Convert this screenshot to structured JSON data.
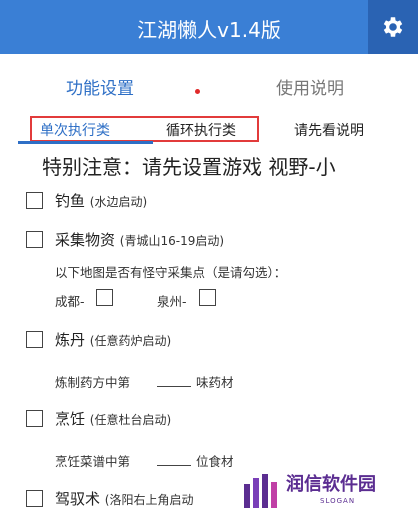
{
  "header": {
    "title": "江湖懒人v1.4版"
  },
  "tabs": [
    {
      "label": "功能设置",
      "active": true
    },
    {
      "label": "使用说明",
      "active": false
    }
  ],
  "subtabs": [
    {
      "label": "单次执行类",
      "active": true
    },
    {
      "label": "循环执行类",
      "active": false
    },
    {
      "label": "请先看说明",
      "active": false
    }
  ],
  "notice": "特别注意：请先设置游戏  视野-小",
  "options": {
    "fishing": {
      "label": "钓鱼",
      "hint": "(水边启动)",
      "checked": false
    },
    "gather": {
      "label": "采集物资",
      "hint": "(青城山16-19启动)",
      "checked": false
    },
    "gather_note": "以下地图是否有怪守采集点（是请勾选）：",
    "chengdu": {
      "label": "成都-",
      "checked": false
    },
    "quanzhou": {
      "label": "泉州-",
      "checked": false
    },
    "alchemy": {
      "label": "炼丹",
      "hint": "(任意药炉启动)",
      "checked": false
    },
    "alchemy_prefix": "炼制药方中第",
    "alchemy_suffix": "味药材",
    "cooking": {
      "label": "烹饪",
      "hint": "(任意杜台启动)",
      "checked": false
    },
    "cooking_prefix": "烹饪菜谱中第",
    "cooking_suffix": "位食材",
    "driving": {
      "label": "驾驭术",
      "hint": "(洛阳右上角启动",
      "checked": false
    }
  },
  "watermark": {
    "text": "润信软件园",
    "slogan": "SLOGAN"
  },
  "colors": {
    "header": "#3a7fd5",
    "accent": "#2e6fc6",
    "highlight": "#e23b3b"
  }
}
